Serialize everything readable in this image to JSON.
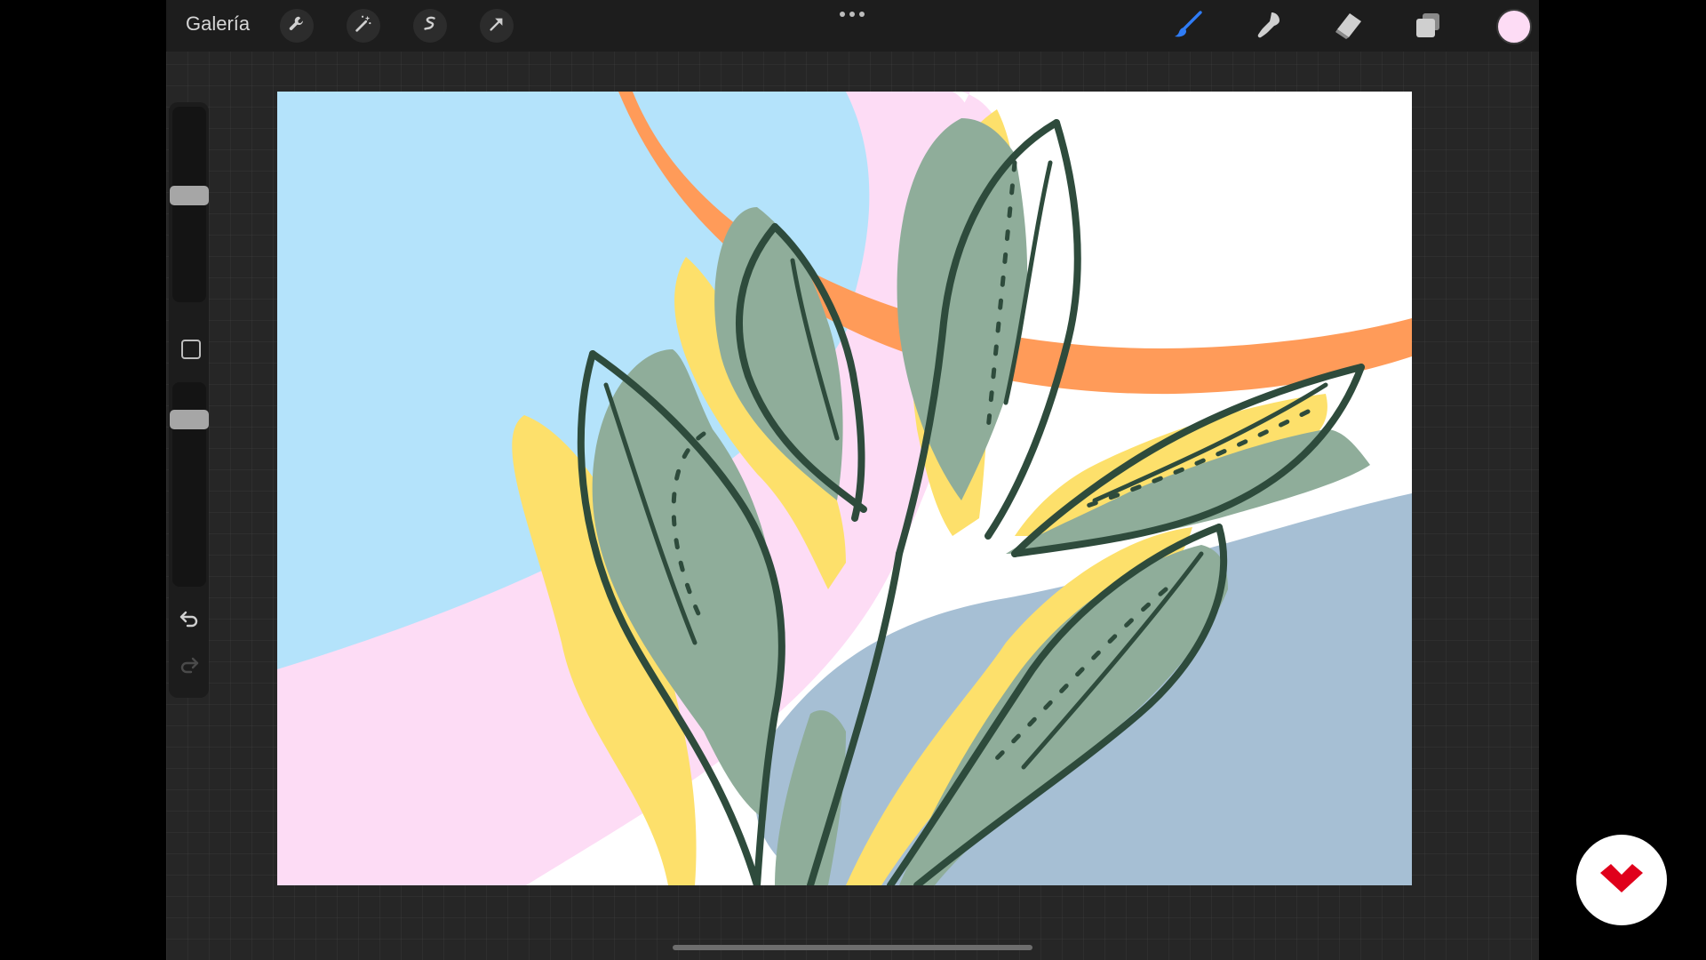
{
  "topbar": {
    "gallery_label": "Galería",
    "left_tools": [
      "wrench-icon",
      "magic-wand-icon",
      "selection-icon",
      "transform-arrow-icon"
    ],
    "center_menu": "more-dots-icon",
    "right_tools": [
      "brush-icon",
      "smudge-icon",
      "eraser-icon",
      "layers-icon"
    ],
    "active_tool": "brush-icon",
    "current_color": "#fddcf5"
  },
  "sidebar": {
    "brush_size_level": 0.55,
    "opacity_level": 0.85,
    "modify_button": "square-modify-icon",
    "undo": "undo-icon",
    "redo": "redo-icon"
  },
  "canvas": {
    "colors": {
      "sky": "#b4e3fb",
      "pink": "#fddcf5",
      "orange": "#ff9b59",
      "slate": "#a6bfd4",
      "yellow": "#fde06b",
      "leaf": "#8fad9a",
      "outline": "#2e4b3c"
    }
  },
  "watermark": {
    "icon": "domestika-logo-icon",
    "color": "#e0001b"
  }
}
